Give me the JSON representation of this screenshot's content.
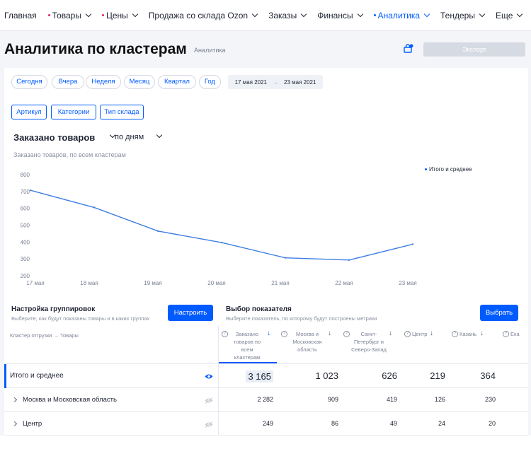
{
  "nav": {
    "items": [
      {
        "label": "Главная",
        "dot": false,
        "chevron": false,
        "active": false
      },
      {
        "label": "Товары",
        "dot": "red",
        "chevron": true,
        "active": false
      },
      {
        "label": "Цены",
        "dot": "red",
        "chevron": true,
        "active": false
      },
      {
        "label": "Продажа со склада Ozon",
        "dot": false,
        "chevron": true,
        "active": false
      },
      {
        "label": "Заказы",
        "dot": false,
        "chevron": true,
        "active": false
      },
      {
        "label": "Финансы",
        "dot": false,
        "chevron": true,
        "active": false
      },
      {
        "label": "Аналитика",
        "dot": "blue",
        "chevron": true,
        "active": true
      },
      {
        "label": "Тендеры",
        "dot": false,
        "chevron": true,
        "active": false
      },
      {
        "label": "Еще",
        "dot": false,
        "chevron": true,
        "active": false
      }
    ]
  },
  "header": {
    "title": "Аналитика по кластерам",
    "breadcrumb": "Аналитика",
    "export_label": "Экспорт"
  },
  "periods": [
    "Сегодня",
    "Вчера",
    "Неделя",
    "Месяц",
    "Квартал",
    "Год"
  ],
  "date_range": {
    "from": "17 мая 2021",
    "sep": "→",
    "to": "23 мая 2021"
  },
  "filters": [
    "Артикул",
    "Категории",
    "Тип склада"
  ],
  "chart_header": {
    "metric": "Заказано товаров",
    "granularity": "по дням",
    "subtitle": "Заказано товаров, по всем кластерам"
  },
  "chart_data": {
    "type": "line",
    "title": "Заказано товаров, по всем кластерам",
    "x": [
      "17 мая",
      "18 мая",
      "19 мая",
      "20 мая",
      "21 мая",
      "22 мая",
      "23 мая"
    ],
    "series": [
      {
        "name": "Итого и среднее",
        "values": [
          707,
          605,
          465,
          397,
          306,
          293,
          387
        ]
      }
    ],
    "yticks": [
      200,
      300,
      400,
      500,
      600,
      700,
      800
    ],
    "ylim": [
      200,
      800
    ],
    "grid": false,
    "legend": "top-right",
    "color": "#3d7fe0"
  },
  "grouping": {
    "title": "Настройка группировок",
    "subtitle": "Выберите, как будут показаны товары и в каких группах",
    "button": "Настроить"
  },
  "metric_select": {
    "title": "Выбор показателя",
    "subtitle": "Выберите показатель, по которому будут построены метрики",
    "button": "Выбрать"
  },
  "table": {
    "first_header": "Кластер отгрузки → Товары",
    "columns": [
      "Заказано товаров по всем кластерам",
      "Москва и Московская область",
      "Санкт-Петербург и Северо-Запад",
      "Центр",
      "Казань",
      "Ека"
    ],
    "rows": [
      {
        "label": "Итого и среднее",
        "values": [
          "3 165",
          "1 023",
          "626",
          "219",
          "364"
        ]
      },
      {
        "label": "Москва и Московская область",
        "values": [
          "2 282",
          "909",
          "419",
          "126",
          "230"
        ]
      },
      {
        "label": "Центр",
        "values": [
          "249",
          "86",
          "49",
          "24",
          "20"
        ]
      }
    ]
  }
}
